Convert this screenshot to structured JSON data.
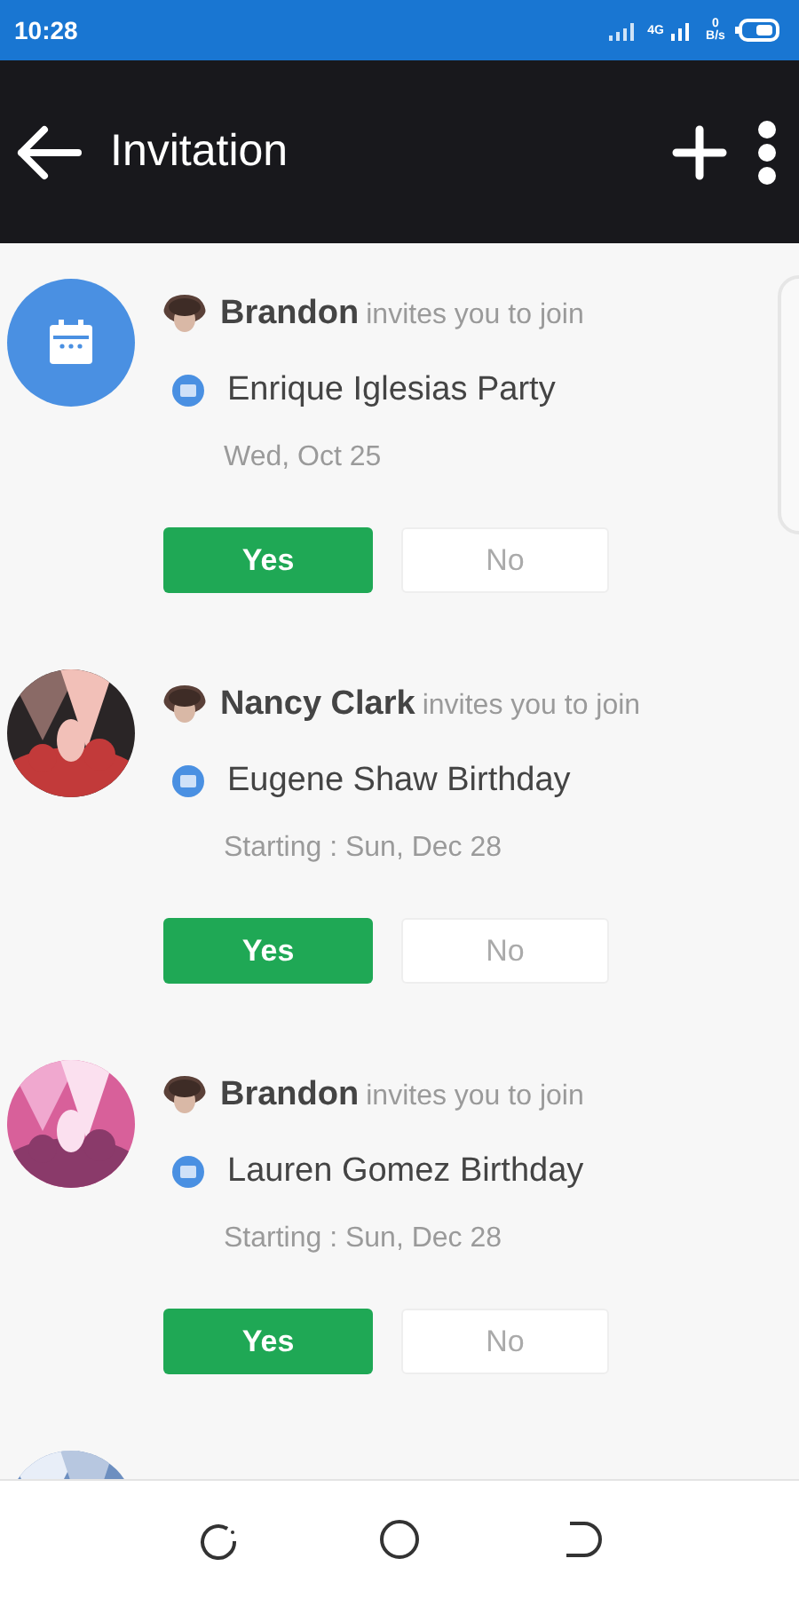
{
  "status_bar": {
    "time": "10:28",
    "network": "4G",
    "speed": "0 B/s"
  },
  "app_bar": {
    "title": "Invitation"
  },
  "invitations": [
    {
      "avatar": {
        "kind": "calendar"
      },
      "sender": "Brandon",
      "action": "invites you to join",
      "event": "Enrique Iglesias Party",
      "date": "Wed, Oct 25",
      "accept": "Yes",
      "decline": "No"
    },
    {
      "avatar": {
        "kind": "picture"
      },
      "sender": "Nancy Clark",
      "action": "invites you to join",
      "event": "Eugene Shaw Birthday",
      "date": "Starting : Sun, Dec 28",
      "accept": "Yes",
      "decline": "No"
    },
    {
      "avatar": {
        "kind": "picture"
      },
      "sender": "Brandon",
      "action": "invites you to join",
      "event": "Lauren Gomez Birthday",
      "date": "Starting : Sun, Dec 28",
      "accept": "Yes",
      "decline": "No"
    },
    {
      "avatar": {
        "kind": "picture"
      }
    }
  ]
}
